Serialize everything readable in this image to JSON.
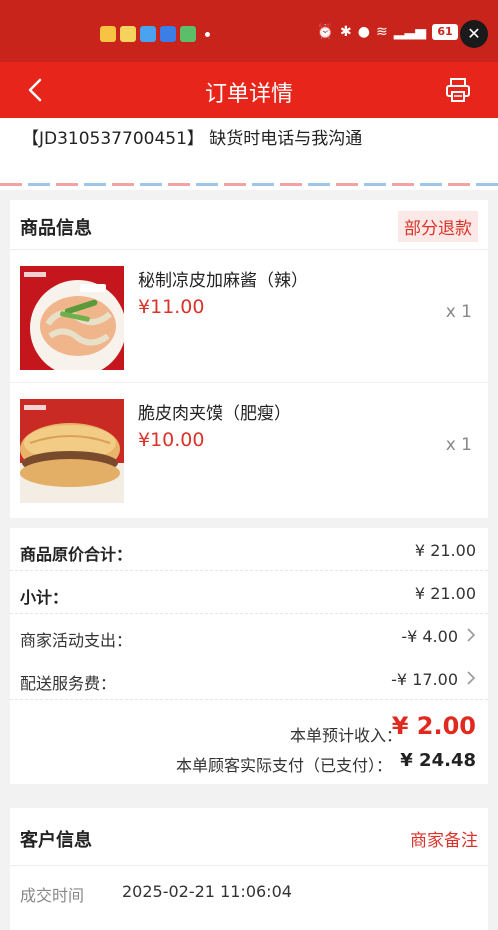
{
  "status_bar": {
    "battery": "61",
    "close_icon": "close-icon"
  },
  "nav": {
    "title": "订单详情",
    "back_icon": "back-chevron-icon",
    "print_icon": "printer-icon"
  },
  "order": {
    "text": "【JD310537700451】 缺货时电话与我沟通"
  },
  "goods": {
    "title": "商品信息",
    "badge": "部分退款",
    "items": [
      {
        "name": "秘制凉皮加麻酱（辣）",
        "price": "¥11.00",
        "qty": "x 1"
      },
      {
        "name": "脆皮肉夹馍（肥瘦）",
        "price": "¥10.00",
        "qty": "x 1"
      }
    ]
  },
  "summary": {
    "original_total_label": "商品原价合计：",
    "original_total_value": "¥ 21.00",
    "subtotal_label": "小计：",
    "subtotal_value": "¥ 21.00",
    "promo_label": "商家活动支出：",
    "promo_value": "-¥ 4.00",
    "delivery_label": "配送服务费：",
    "delivery_value": "-¥ 17.00",
    "income_label": "本单预计收入：",
    "income_value": "¥ 2.00",
    "paid_label": "本单顾客实际支付（已支付）：",
    "paid_value": "¥ 24.48"
  },
  "customer": {
    "title": "客户信息",
    "note_link": "商家备注",
    "deal_time_label": "成交时间",
    "deal_time_value": "2025-02-21 11:06:04"
  },
  "colors": {
    "brand_red": "#e8251a",
    "price_red": "#d9342b"
  }
}
